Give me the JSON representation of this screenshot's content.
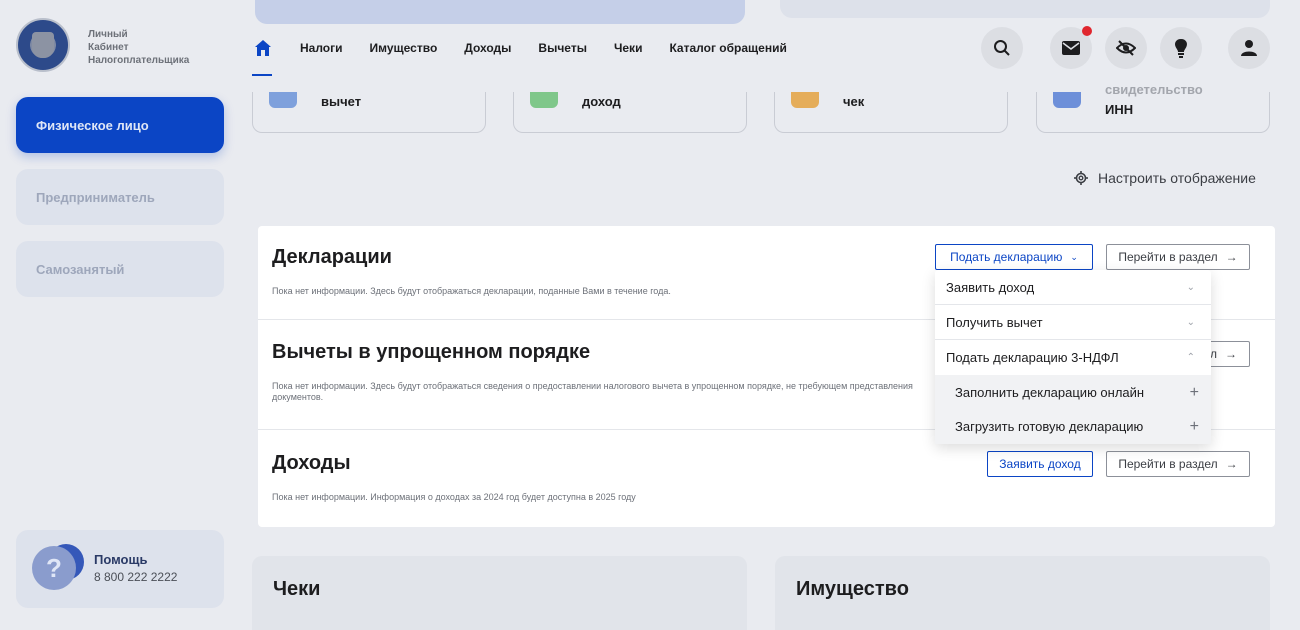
{
  "brand": {
    "line1": "Личный",
    "line2": "Кабинет",
    "line3": "Налогоплательщика"
  },
  "sidebar": {
    "items": [
      {
        "label": "Физическое лицо",
        "active": true
      },
      {
        "label": "Предприниматель",
        "active": false
      },
      {
        "label": "Самозанятый",
        "active": false
      }
    ],
    "help": {
      "title": "Помощь",
      "phone": "8 800 222 2222"
    }
  },
  "nav": {
    "items": [
      "Налоги",
      "Имущество",
      "Доходы",
      "Вычеты",
      "Чеки",
      "Каталог обращений"
    ],
    "icons": [
      "search-icon",
      "mail-icon",
      "hide-eye-icon",
      "lightbulb-icon",
      "profile-icon"
    ],
    "accent": "#0b45c5",
    "notification_color": "#e0262e"
  },
  "quick_cards": [
    {
      "label": "вычет"
    },
    {
      "label": "доход"
    },
    {
      "label": "чек"
    },
    {
      "label_top": "свидетельство",
      "label": "ИНН"
    }
  ],
  "configure": {
    "label": "Настроить отображение"
  },
  "sections": {
    "declarations": {
      "title": "Декларации",
      "desc": "Пока нет информации. Здесь будут отображаться декларации, поданные Вами в течение года.",
      "primary_button": "Подать декларацию",
      "goto_button": "Перейти в раздел"
    },
    "deductions": {
      "title": "Вычеты в упрощенном порядке",
      "desc": "Пока нет информации. Здесь будут отображаться сведения о предоставлении налогового вычета в упрощенном порядке, не требующем представления документов.",
      "goto_button_partial": "л"
    },
    "income": {
      "title": "Доходы",
      "desc": "Пока нет информации. Информация о доходах за 2024 год будет доступна в 2025 году",
      "primary_button": "Заявить доход",
      "goto_button": "Перейти в раздел"
    }
  },
  "dropdown": {
    "items": [
      {
        "label": "Заявить доход",
        "type": "collapsed"
      },
      {
        "label": "Получить вычет",
        "type": "collapsed"
      },
      {
        "label": "Подать декларацию 3-НДФЛ",
        "type": "expanded"
      },
      {
        "label": "Заполнить декларацию онлайн",
        "type": "sub"
      },
      {
        "label": "Загрузить готовую декларацию",
        "type": "sub"
      }
    ]
  },
  "lower_cards": [
    {
      "title": "Чеки"
    },
    {
      "title": "Имущество"
    }
  ]
}
